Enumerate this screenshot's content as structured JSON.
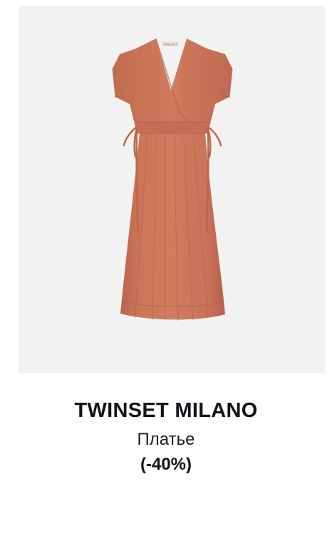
{
  "product": {
    "brand": "TWINSET MILANO",
    "type": "Платье",
    "discount": "(-40%)",
    "image": {
      "subject": "dress-photo",
      "background_color": "#f2f2f2",
      "dress_color": "#c97457",
      "label_text": "TWINSET"
    }
  }
}
